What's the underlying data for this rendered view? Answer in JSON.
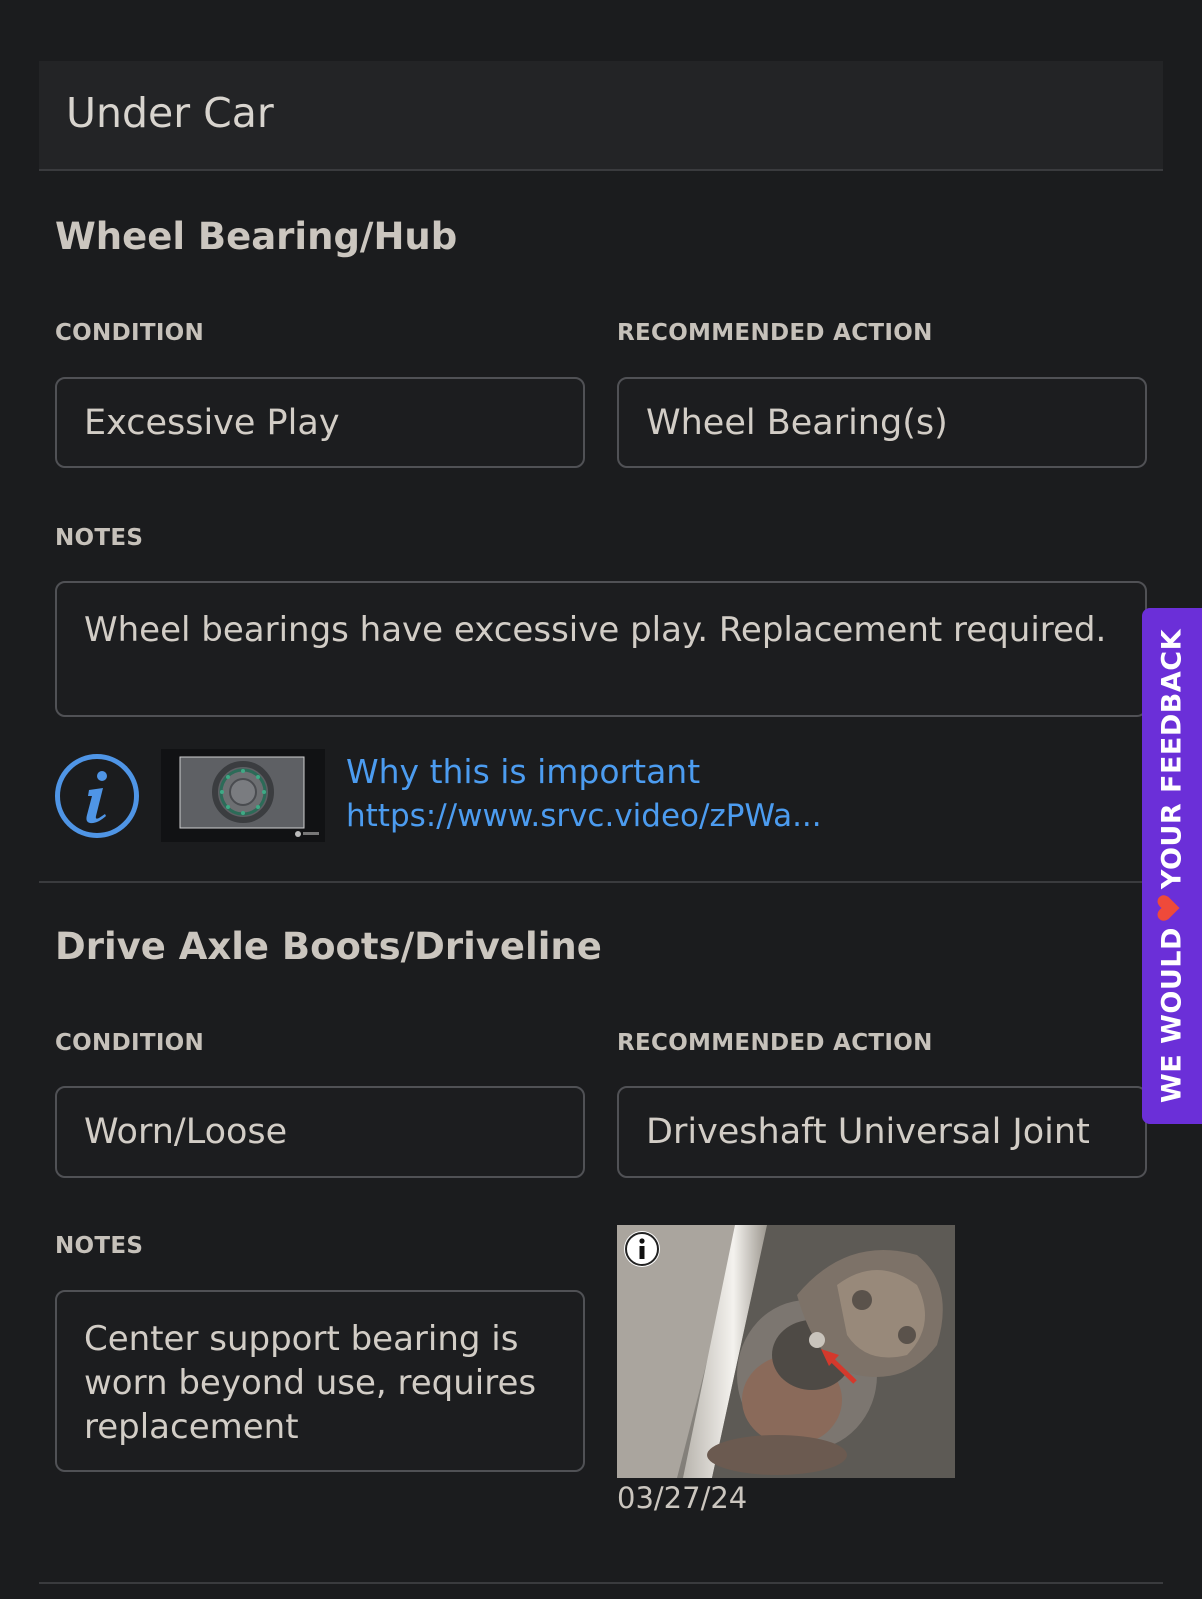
{
  "section": {
    "title": "Under Car"
  },
  "items": [
    {
      "title": "Wheel Bearing/Hub",
      "condition_label": "CONDITION",
      "condition_value": "Excessive Play",
      "action_label": "RECOMMENDED ACTION",
      "action_value": "Wheel Bearing(s)",
      "notes_label": "NOTES",
      "notes_value": "Wheel bearings have excessive play. Replacement required.",
      "info": {
        "link_title": "Why this is important",
        "link_url": "https://www.srvc.video/zPWa..."
      }
    },
    {
      "title": "Drive Axle Boots/Driveline",
      "condition_label": "CONDITION",
      "condition_value": "Worn/Loose",
      "action_label": "RECOMMENDED ACTION",
      "action_value": "Driveshaft Universal Joint",
      "notes_label": "NOTES",
      "notes_value": "Center support bearing is worn beyond use, requires replacement",
      "photo": {
        "date": "03/27/24"
      }
    }
  ],
  "feedback": {
    "text_before": "WE WOULD",
    "text_after": "YOUR FEEDBACK",
    "heart_icon": "heart-icon",
    "accent": "#6b2fd8"
  },
  "colors": {
    "background": "#1b1c1e",
    "link": "#4c9cf0",
    "info_icon": "#4f95e6"
  }
}
